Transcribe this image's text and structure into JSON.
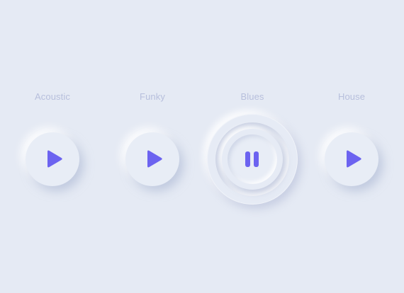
{
  "colors": {
    "background": "#e5eaf4",
    "accent": "#6c63f0",
    "label": "#b7bfdc"
  },
  "tracks": [
    {
      "label": "Acoustic",
      "state": "paused",
      "icon": "play-icon"
    },
    {
      "label": "Funky",
      "state": "paused",
      "icon": "play-icon"
    },
    {
      "label": "Blues",
      "state": "playing",
      "icon": "pause-icon"
    },
    {
      "label": "House",
      "state": "paused",
      "icon": "play-icon"
    }
  ]
}
